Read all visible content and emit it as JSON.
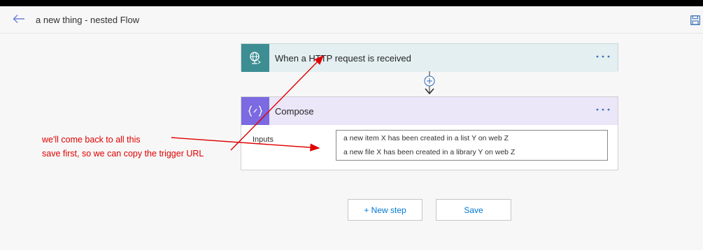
{
  "header": {
    "title": "a new thing - nested Flow"
  },
  "trigger": {
    "title": "When a HTTP request is received"
  },
  "compose": {
    "title": "Compose",
    "inputs_label": "Inputs",
    "inputs_lines": [
      "a new item X has been created in a list Y on web Z",
      "a new file X has been created in a library Y on web Z"
    ]
  },
  "actions": {
    "new_step_label": "+ New step",
    "save_label": "Save"
  },
  "annotations": [
    "we'll come back to all this",
    "save first, so we can copy the trigger URL"
  ],
  "icons": {
    "back": "back-arrow-icon",
    "save": "floppy-disk-icon",
    "trigger": "globe-request-icon",
    "compose": "curly-braces-icon",
    "more": "ellipsis-icon",
    "add": "plus-circle-icon"
  },
  "colors": {
    "accent": "#0078d4",
    "trigger_icon_bg": "#3d8e93",
    "trigger_header_bg": "#e3eff1",
    "compose_icon_bg": "#7b6ae2",
    "compose_header_bg": "#ebe6f8",
    "annotation": "#e00000"
  }
}
